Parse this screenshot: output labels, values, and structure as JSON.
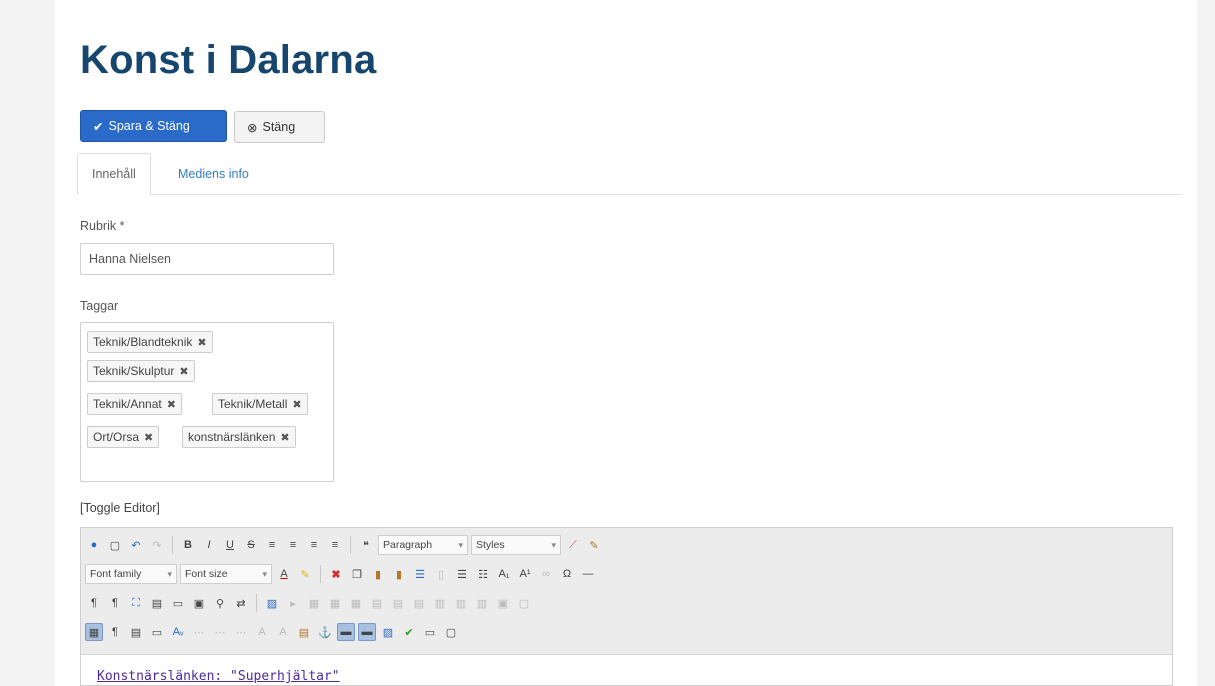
{
  "header": {
    "title": "Konst i Dalarna"
  },
  "actions": {
    "save_label": "Spara & Stäng",
    "close_label": "Stäng"
  },
  "tabs": [
    {
      "label": "Innehåll"
    },
    {
      "label": "Mediens info"
    }
  ],
  "form": {
    "heading_label": "Rubrik *",
    "heading_value": "Hanna Nielsen",
    "tags_label": "Taggar",
    "tags": [
      "Teknik/Blandteknik",
      "Teknik/Skulptur",
      "Teknik/Annat",
      "Teknik/Metall",
      "Ort/Orsa",
      "konstnärslänken"
    ],
    "tag_remove_glyph": "✖"
  },
  "editor": {
    "toggle_label": "[Toggle Editor]",
    "format_select": "Paragraph",
    "styles_select": "Styles",
    "font_family_select": "Font family",
    "font_size_select": "Font size",
    "content_link_text": "Konstnärslänken: \"Superhjältar\""
  },
  "colors": {
    "accent": "#2a6ac8",
    "title": "#16466e",
    "link": "#2e7ec7"
  }
}
